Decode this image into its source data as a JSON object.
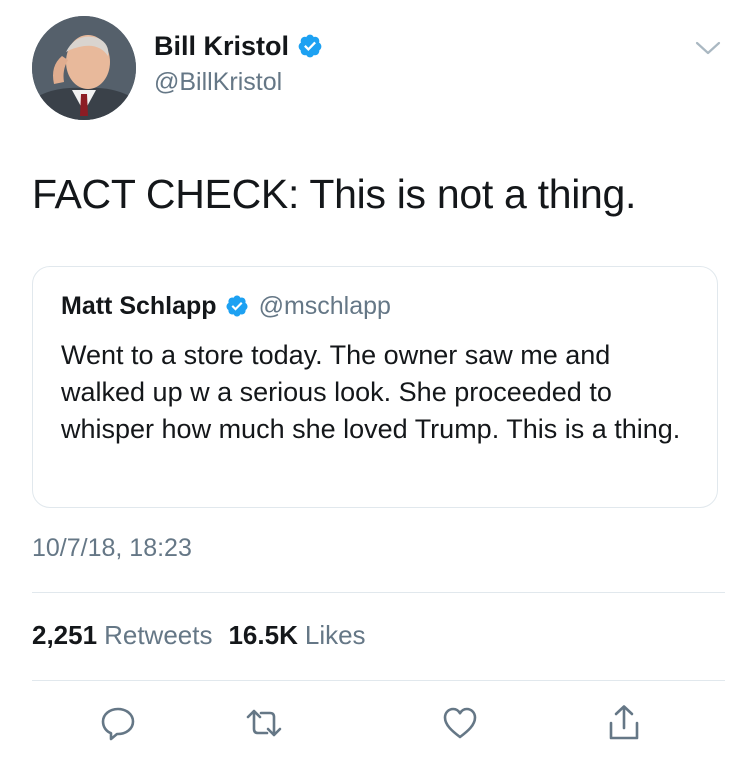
{
  "author": {
    "name": "Bill Kristol",
    "handle": "@BillKristol",
    "verified": true
  },
  "tweet": {
    "text": "FACT CHECK: This is not a thing."
  },
  "quoted_tweet": {
    "name": "Matt Schlapp",
    "handle": "@mschlapp",
    "verified": true,
    "text": "Went to a store today. The owner saw me and walked up w a serious look. She proceeded to whisper how much she loved Trump. This is a thing."
  },
  "timestamp": "10/7/18, 18:23",
  "stats": {
    "retweets_count": "2,251",
    "retweets_label": "Retweets",
    "likes_count": "16.5K",
    "likes_label": "Likes"
  },
  "icons": {
    "menu": "chevron-down-icon",
    "verified": "verified-badge-icon",
    "reply": "reply-icon",
    "retweet": "retweet-icon",
    "like": "heart-icon",
    "share": "share-icon"
  },
  "colors": {
    "verified_blue": "#1da1f2",
    "secondary_text": "#657786",
    "primary_text": "#14171a",
    "divider": "#e1e8ed"
  }
}
